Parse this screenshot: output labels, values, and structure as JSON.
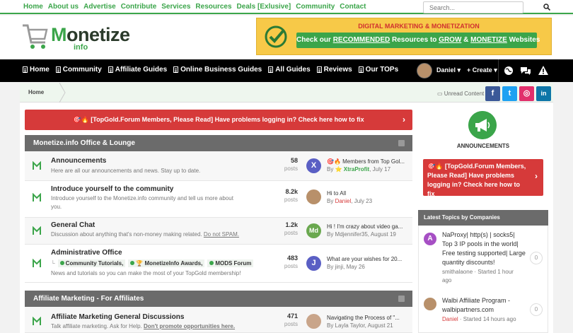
{
  "top_links": [
    "Home",
    "About us",
    "Advertise",
    "Contribute",
    "Services",
    "Resources",
    "Deals [Exlusive]",
    "Community",
    "Contact"
  ],
  "search": {
    "placeholder": "Search..."
  },
  "logo": {
    "first_letter": "M",
    "rest": "onetize",
    "sub": "info"
  },
  "banner": {
    "line1": "DIGITAL MARKETING & MONETIZATION",
    "line2_pre": "Check our ",
    "line2_recommended": "RECOMMENDED",
    "line2_mid": " Resources to ",
    "line2_grow": "GROW",
    "line2_and": " & ",
    "line2_monetize": "MONETIZE",
    "line2_post": " Websites"
  },
  "nav": {
    "items": [
      "Home",
      "Community",
      "Affiliate Guides",
      "Online Business Guides",
      "All Guides",
      "Reviews",
      "Our TOPs"
    ],
    "user": "Daniel",
    "create": "+ Create"
  },
  "breadcrumb": {
    "home": "Home",
    "unread": "Unread Content"
  },
  "social": [
    "f",
    "t",
    "◎",
    "in"
  ],
  "notice_text": "🎯🔥 [TopGold.Forum Members, Please Read] Have problems logging in? Check here how to fix",
  "categories": [
    {
      "title": "Monetize.info Office & Lounge"
    },
    {
      "title": "Affiliate Marketing - For Affiliates"
    }
  ],
  "forums": [
    {
      "title": "Announcements",
      "desc": "Here are all our announcements and news. Stay up to date.",
      "count": "58",
      "count_label": "posts",
      "avatar_letter": "X",
      "last_title": "🎯🔥 Members from Top Gol...",
      "last_by": "By",
      "last_user": "⭐ XtraProfit",
      "last_date": ", July 17"
    },
    {
      "title": "Introduce yourself to the community",
      "desc1": "Introduce yourself to the Monetize.info community and tell us more about",
      "desc2": "you.",
      "count": "8.2k",
      "count_label": "posts",
      "last_title": "Hi to All",
      "last_by": "By",
      "last_user": "Daniel",
      "last_date": ", July 23"
    },
    {
      "title": "General Chat",
      "desc_pre": "Discussion about anything that's non-money making related. ",
      "desc_link": "Do not SPAM.",
      "count": "1.2k",
      "count_label": "posts",
      "avatar_letter": "Md",
      "last_title": "Hi ! I'm crazy about video ga...",
      "last_meta": "By Mdjennifer35, August 19"
    },
    {
      "title": "Administrative Office",
      "subforums": [
        "Community Tutorials",
        "🏆 MonetizeInfo Awards",
        "MODS Forum"
      ],
      "desc": "News and tutorials so you can make the most of your TopGold membership!",
      "count": "483",
      "count_label": "posts",
      "avatar_letter": "J",
      "last_title": "What are your wishes for 20...",
      "last_meta": "By jinji, May 26"
    },
    {
      "title": "Affiliate Marketing General Discussions",
      "desc_pre": "Talk affiliate marketing. Ask for Help. ",
      "desc_link": "Don't promote opportunities here.",
      "count": "471",
      "count_label": "posts",
      "last_title": "Navigating the Process of \"...",
      "last_meta": "By Layla Taylor, August 21"
    }
  ],
  "sidebar": {
    "announcements_title": "ANNOUNCEMENTS",
    "notice_text": "🎯🔥 [TopGold.Forum Members, Please Read] Have problems logging in? Check here how to fix",
    "latest_title": "Latest Topics by Companies",
    "topics": [
      {
        "avatar_letter": "A",
        "lines": [
          "NaProxy| http(s) | socks5|",
          "Top 3 IP pools in the world|",
          "Free testing supported| Large",
          "quantity discounts!"
        ],
        "meta1": "smithalaone · Started 1 hour",
        "meta2": "ago",
        "count": "0"
      },
      {
        "lines": [
          "Walbi Affiliate Program -",
          "walbipartners.com"
        ],
        "meta_user": "Daniel",
        "meta_rest": " · Started 14 hours ago",
        "count": "0"
      }
    ]
  },
  "colors": {
    "brand_green": "#3ba54a",
    "notice_red": "#d63a3a",
    "navbar": "#000000",
    "category_header": "#6b6b6b"
  }
}
